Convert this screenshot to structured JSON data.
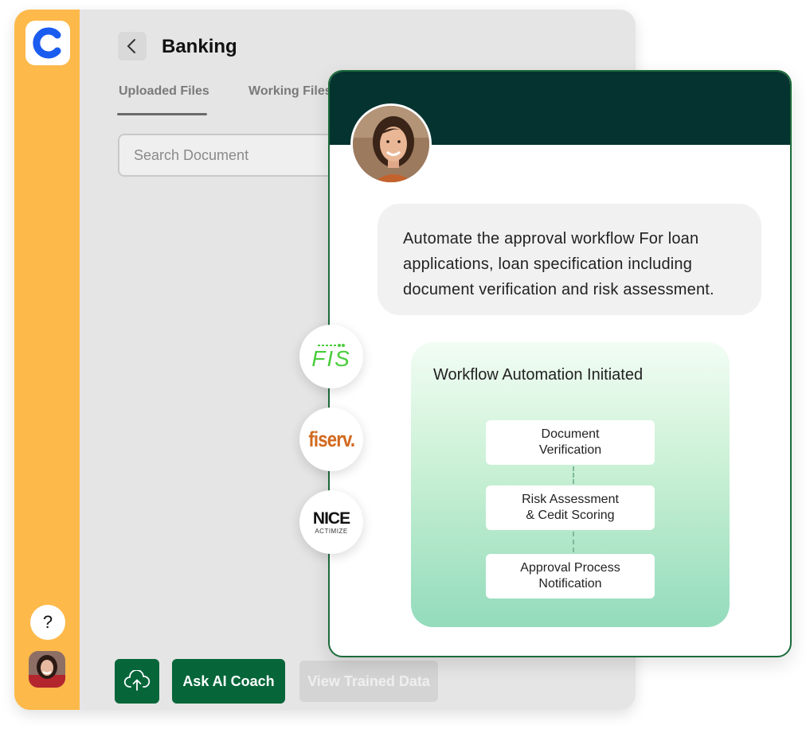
{
  "app": {
    "logo_letter": "C",
    "title": "Banking",
    "tabs": [
      {
        "label": "Uploaded Files",
        "active": true
      },
      {
        "label": "Working Files",
        "active": false
      }
    ],
    "search": {
      "placeholder": "Search Document",
      "value": ""
    },
    "help_label": "?",
    "buttons": {
      "upload_icon": "cloud-upload-icon",
      "ask_coach": "Ask AI Coach",
      "view_trained": "View Trained Data"
    }
  },
  "integrations": [
    {
      "name": "FIS",
      "logo_text": "FIS"
    },
    {
      "name": "fiserv",
      "logo_text": "fiserv."
    },
    {
      "name": "NICE Actimize",
      "logo_text": "NICE",
      "sub": "ACTIMIZE"
    }
  ],
  "chat": {
    "message": "Automate the approval workflow For loan applications,  loan specification including document verification and risk assessment.",
    "workflow": {
      "title": "Workflow Automation Initiated",
      "steps": [
        "Document\nVerification",
        "Risk Assessment\n& Cedit Scoring",
        "Approval Process\nNotification"
      ]
    }
  },
  "colors": {
    "rail": "#fdb94a",
    "primary_button": "#06663a",
    "card_header": "#053430",
    "card_border": "#1c6b3a",
    "logo_blue": "#1a5cf0"
  }
}
